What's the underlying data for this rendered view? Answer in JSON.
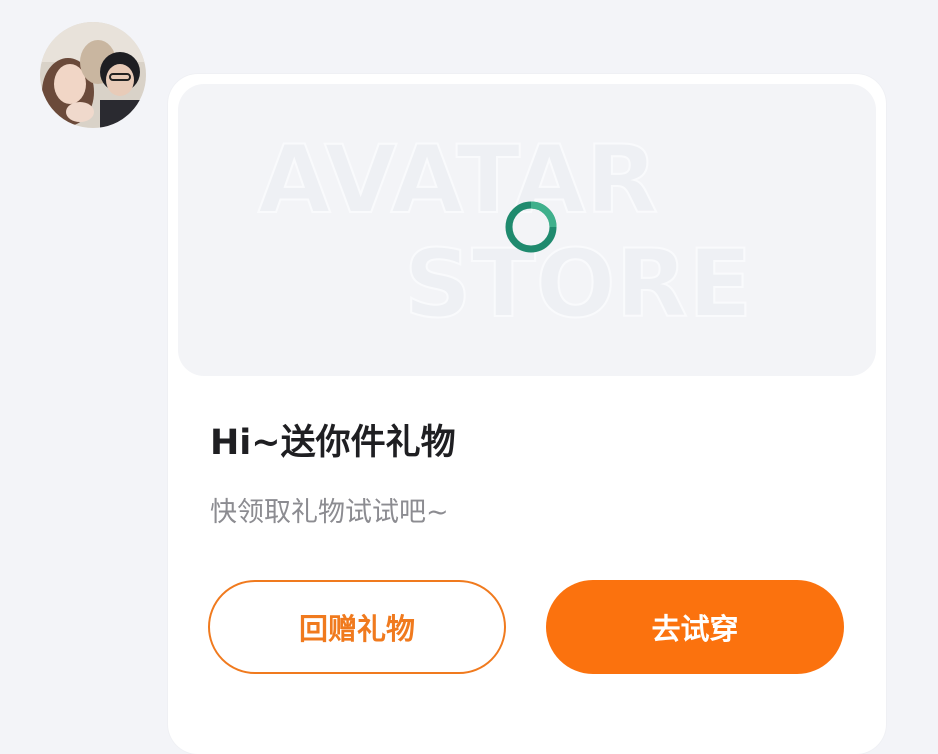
{
  "sender": {
    "avatar_icon": "user-avatar-photo"
  },
  "gift_card": {
    "watermark_line1": "AVATAR",
    "watermark_line2": "STORE",
    "loading_icon": "loading-spinner-icon",
    "title": "Hi~送你件礼物",
    "subtitle": "快领取礼物试试吧~",
    "return_gift_label": "回赠礼物",
    "try_on_label": "去试穿"
  },
  "colors": {
    "accent": "#fb720e",
    "outline_accent": "#f07a1e",
    "spinner": "#1f8a6e",
    "page_bg": "#f3f4f8",
    "card_bg": "#ffffff"
  }
}
